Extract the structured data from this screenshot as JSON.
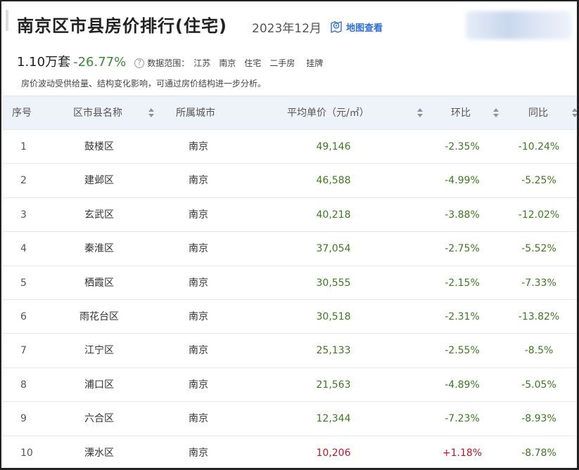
{
  "header": {
    "title": "南京区市县房价排行(住宅)",
    "date": "2023年12月",
    "map_link": "地图查看",
    "count": "1.10万套",
    "change": "-26.77%",
    "help_icon": "?",
    "scope_label": "数据范围：",
    "scope_tags": [
      "江苏",
      "南京",
      "住宅",
      "二手房",
      "挂牌"
    ],
    "note": "房价波动受供给量、结构变化影响，可通过房价结构进一步分析。"
  },
  "colors": {
    "accent": "#2f6fd6",
    "down": "#3c7a1f",
    "up": "#c0132a",
    "header_bg": "#eef3fa"
  },
  "table": {
    "columns": {
      "idx": "序号",
      "name": "区市县名称",
      "city": "所属城市",
      "price": "平均单价（元/㎡）",
      "mom": "环比",
      "yoy": "同比"
    },
    "rows": [
      {
        "idx": "1",
        "name": "鼓楼区",
        "city": "南京",
        "price": "49,146",
        "mom": "-2.35%",
        "yoy": "-10.24%"
      },
      {
        "idx": "2",
        "name": "建邺区",
        "city": "南京",
        "price": "46,588",
        "mom": "-4.99%",
        "yoy": "-5.25%"
      },
      {
        "idx": "3",
        "name": "玄武区",
        "city": "南京",
        "price": "40,218",
        "mom": "-3.88%",
        "yoy": "-12.02%"
      },
      {
        "idx": "4",
        "name": "秦淮区",
        "city": "南京",
        "price": "37,054",
        "mom": "-2.75%",
        "yoy": "-5.52%"
      },
      {
        "idx": "5",
        "name": "栖霞区",
        "city": "南京",
        "price": "30,555",
        "mom": "-2.15%",
        "yoy": "-7.33%"
      },
      {
        "idx": "6",
        "name": "雨花台区",
        "city": "南京",
        "price": "30,518",
        "mom": "-2.31%",
        "yoy": "-13.82%"
      },
      {
        "idx": "7",
        "name": "江宁区",
        "city": "南京",
        "price": "25,133",
        "mom": "-2.55%",
        "yoy": "-8.5%"
      },
      {
        "idx": "8",
        "name": "浦口区",
        "city": "南京",
        "price": "21,563",
        "mom": "-4.89%",
        "yoy": "-5.05%"
      },
      {
        "idx": "9",
        "name": "六合区",
        "city": "南京",
        "price": "12,344",
        "mom": "-7.23%",
        "yoy": "-8.93%"
      },
      {
        "idx": "10",
        "name": "溧水区",
        "city": "南京",
        "price": "10,206",
        "mom": "+1.18%",
        "yoy": "-8.78%"
      }
    ]
  }
}
